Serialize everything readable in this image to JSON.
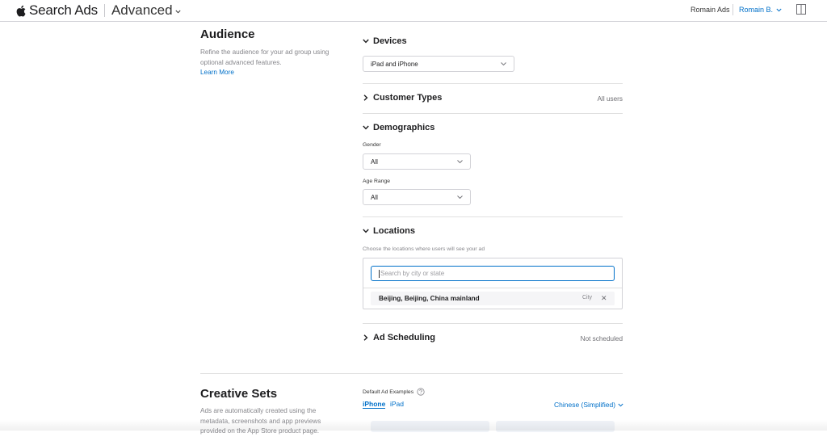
{
  "header": {
    "brand": "Search Ads",
    "mode": "Advanced",
    "account": "Romain Ads",
    "user": "Romain B."
  },
  "audience": {
    "title": "Audience",
    "description": "Refine the audience for your ad group using optional advanced features.",
    "learn_more": "Learn More"
  },
  "devices": {
    "label": "Devices",
    "value": "iPad and iPhone"
  },
  "customer_types": {
    "label": "Customer Types",
    "value": "All users"
  },
  "demographics": {
    "label": "Demographics",
    "gender_label": "Gender",
    "gender_value": "All",
    "age_label": "Age Range",
    "age_value": "All"
  },
  "locations": {
    "label": "Locations",
    "hint": "Choose the locations where users will see your ad",
    "search_placeholder": "Search by city or state",
    "items": [
      {
        "name": "Beijing, Beijing, China mainland",
        "type": "City"
      }
    ]
  },
  "ad_scheduling": {
    "label": "Ad Scheduling",
    "value": "Not scheduled"
  },
  "creative_sets": {
    "title": "Creative Sets",
    "description": "Ads are automatically created using the metadata, screenshots and app previews provided on the App Store product page.",
    "examples_label": "Default Ad Examples",
    "tabs": [
      "iPhone",
      "iPad"
    ],
    "language": "Chinese (Simplified)"
  },
  "colors": {
    "accent": "#0070c9",
    "divider": "#e0e0e0",
    "text_secondary": "#86868b"
  }
}
